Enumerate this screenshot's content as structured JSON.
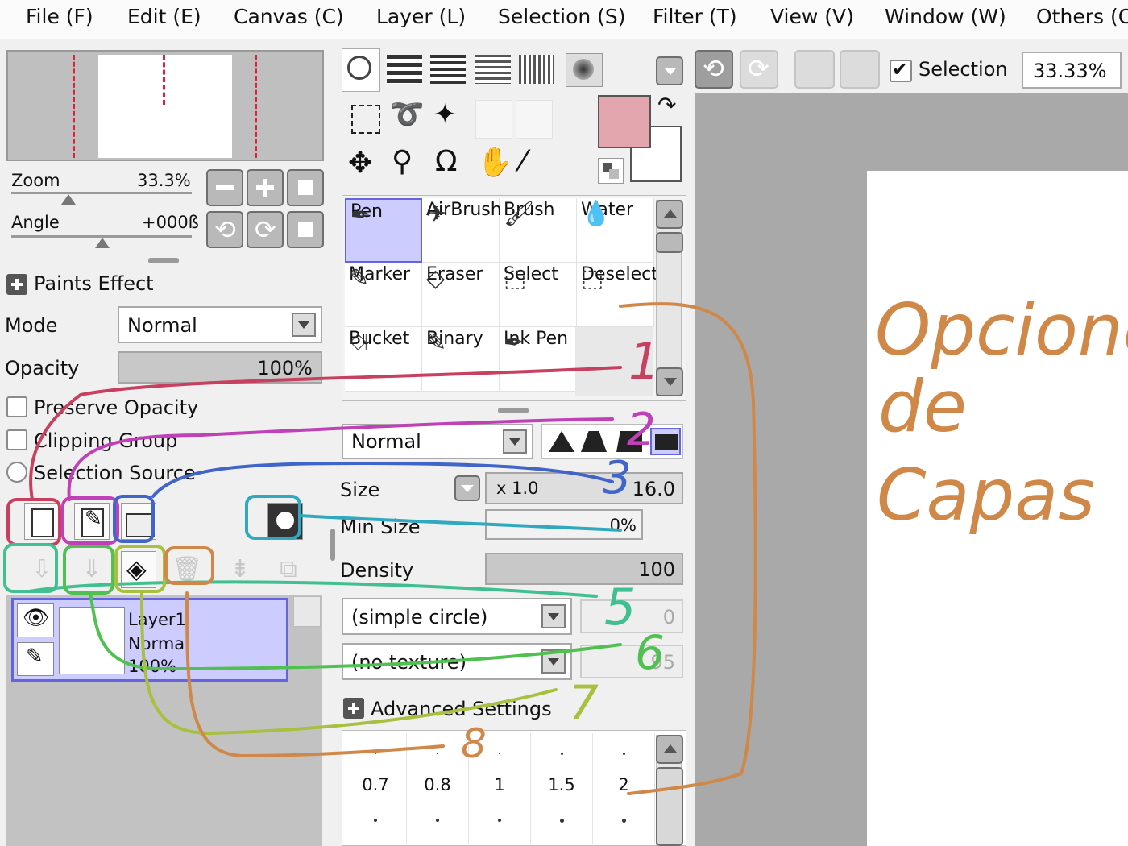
{
  "menu": [
    "File (F)",
    "Edit (E)",
    "Canvas (C)",
    "Layer (L)",
    "Selection (S)",
    "Filter (T)",
    "View (V)",
    "Window (W)",
    "Others (O"
  ],
  "navigator": {
    "zoom_label": "Zoom",
    "zoom_value": "33.3%",
    "angle_label": "Angle",
    "angle_value": "+000ß"
  },
  "paints_effect": {
    "title": "Paints Effect",
    "mode_label": "Mode",
    "mode_value": "Normal",
    "opacity_label": "Opacity",
    "opacity_value": "100%",
    "preserve_opacity": "Preserve Opacity",
    "clipping_group": "Clipping Group",
    "selection_source": "Selection Source"
  },
  "layer": {
    "name": "Layer1",
    "mode": "Normal",
    "opacity": "100%"
  },
  "toolbar": {
    "selection_label": "Selection",
    "zoom_value": "33.33%"
  },
  "colors": {
    "primary": "#e3a5ae",
    "secondary": "#ffffff",
    "accent": "#ccccff"
  },
  "tools": [
    {
      "label": "Pen",
      "icon": "pen-icon"
    },
    {
      "label": "AirBrush",
      "icon": "airbrush-icon"
    },
    {
      "label": "Brush",
      "icon": "brush-icon"
    },
    {
      "label": "Water",
      "icon": "water-icon"
    },
    {
      "label": "Marker",
      "icon": "marker-icon"
    },
    {
      "label": "Eraser",
      "icon": "eraser-icon"
    },
    {
      "label": "Select",
      "icon": "select-icon"
    },
    {
      "label": "Deselect",
      "icon": "deselect-icon"
    },
    {
      "label": "Bucket",
      "icon": "bucket-icon"
    },
    {
      "label": "Binary",
      "icon": "binary-icon"
    },
    {
      "label": "Ink Pen",
      "icon": "ink-pen-icon"
    }
  ],
  "brush": {
    "blend_mode": "Normal",
    "size_label": "Size",
    "size_multiplier": "x 1.0",
    "size_value": "16.0",
    "min_size_label": "Min Size",
    "min_size_value": "0%",
    "density_label": "Density",
    "density_value": "100",
    "shape": "(simple circle)",
    "shape_value": "0",
    "texture": "(no texture)",
    "texture_value": "95",
    "advanced_label": "Advanced Settings",
    "presets": [
      "0.7",
      "0.8",
      "1",
      "1.5",
      "2"
    ]
  },
  "annotation": {
    "numbers": [
      "1",
      "2",
      "3",
      "5",
      "6",
      "7",
      "8"
    ],
    "note_line1": "Opciones",
    "note_line2": "de",
    "note_line3": "Capas"
  }
}
